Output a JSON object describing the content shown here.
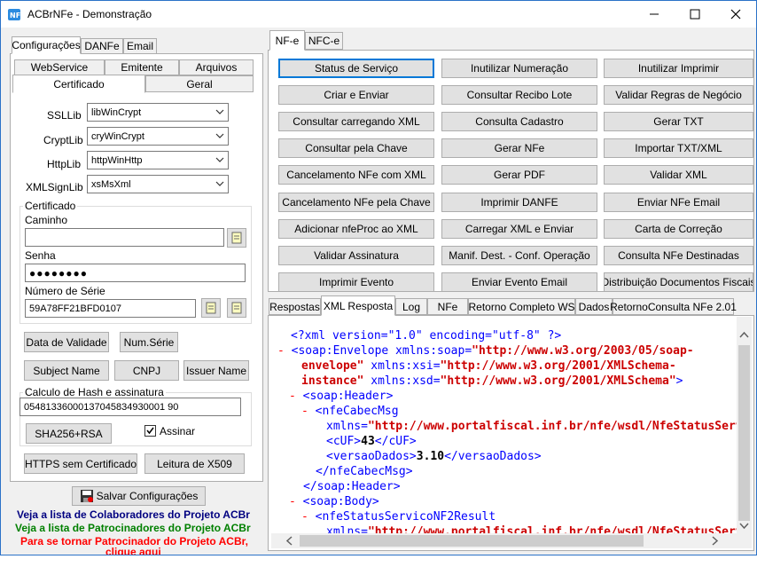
{
  "window": {
    "title": "ACBrNFe - Demonstração"
  },
  "left_tabs": [
    "Configurações",
    "DANFe",
    "Email"
  ],
  "config_tabs_row1": [
    "WebService",
    "Emitente",
    "Arquivos"
  ],
  "config_tabs_row2": [
    "Certificado",
    "Geral"
  ],
  "cert_settings": {
    "ssllib_label": "SSLLib",
    "ssllib_value": "libWinCrypt",
    "cryptlib_label": "CryptLib",
    "cryptlib_value": "cryWinCrypt",
    "httplib_label": "HttpLib",
    "httplib_value": "httpWinHttp",
    "xmlsignlib_label": "XMLSignLib",
    "xmlsignlib_value": "xsMsXml"
  },
  "certificado": {
    "group_title": "Certificado",
    "caminho_label": "Caminho",
    "caminho_value": "",
    "senha_label": "Senha",
    "senha_value": "●●●●●●●●",
    "serie_label": "Número de Série",
    "serie_value": "59A78FF21BFD0107"
  },
  "cert_buttons": {
    "data_validade": "Data de Validade",
    "num_serie": "Num.Série",
    "subject_name": "Subject Name",
    "cnpj": "CNPJ",
    "issuer_name": "Issuer Name"
  },
  "hash": {
    "group_title": "Calculo de Hash e assinatura",
    "value": "05481336000137045834930001 90",
    "sha_button": "SHA256+RSA",
    "assinar_label": "Assinar"
  },
  "bottom_buttons": {
    "https": "HTTPS sem Certificado",
    "leitura": "Leitura de X509"
  },
  "save_button": "Salvar Configurações",
  "links": {
    "colaboradores": "Veja a lista de Colaboradores do Projeto ACBr",
    "patrocinadores": "Veja a lista de Patrocinadores do Projeto ACBr",
    "patrocinador": "Para se tornar Patrocinador do Projeto ACBr,",
    "clique": "clique aqui",
    "color_blue": "#000080",
    "color_green": "#008000",
    "color_red": "#ff0000"
  },
  "right_tabs": [
    "NF-e",
    "NFC-e"
  ],
  "action_buttons": [
    [
      "Status de Serviço",
      "Inutilizar Numeração",
      "Inutilizar Imprimir"
    ],
    [
      "Criar e Enviar",
      "Consultar Recibo Lote",
      "Validar Regras de Negócio"
    ],
    [
      "Consultar carregando XML",
      "Consulta Cadastro",
      "Gerar TXT"
    ],
    [
      "Consultar pela Chave",
      "Gerar NFe",
      "Importar TXT/XML"
    ],
    [
      "Cancelamento NFe com XML",
      "Gerar PDF",
      "Validar XML"
    ],
    [
      "Cancelamento NFe pela Chave",
      "Imprimir DANFE",
      "Enviar NFe Email"
    ],
    [
      "Adicionar nfeProc ao XML",
      "Carregar XML e Enviar",
      "Carta de Correção"
    ],
    [
      "Validar Assinatura",
      "Manif. Dest. - Conf. Operação",
      "Consulta NFe Destinadas"
    ],
    [
      "Imprimir Evento",
      "Enviar Evento Email",
      "Distribuição Documentos Fiscais"
    ]
  ],
  "result_tabs": [
    "Respostas",
    "XML Resposta",
    "Log",
    "NFe",
    "Retorno Completo WS",
    "Dados",
    "RetornoConsulta NFe 2.01"
  ],
  "xml_lines": {
    "l1": "<?xml version=\"1.0\" encoding=\"utf-8\" ?>",
    "l2a": "<soap:Envelope xmlns:soap=",
    "l2b": "\"http://www.w3.org/2003/05/soap-",
    "l3a": "envelope\"",
    "l3b": " xmlns:xsi=",
    "l3c": "\"http://www.w3.org/2001/XMLSchema-",
    "l4a": "instance\"",
    "l4b": " xmlns:xsd=",
    "l4c": "\"http://www.w3.org/2001/XMLSchema\"",
    "l4d": ">",
    "l5": "<soap:Header>",
    "l6": "<nfeCabecMsg",
    "l7a": "xmlns=",
    "l7b": "\"http://www.portalfiscal.inf.br/nfe/wsdl/NfeStatusServico",
    "l8a": "<cUF>",
    "l8b": "43",
    "l8c": "</cUF>",
    "l9a": "<versaoDados>",
    "l9b": "3.10",
    "l9c": "</versaoDados>",
    "l10": "</nfeCabecMsg>",
    "l11": "</soap:Header>",
    "l12": "<soap:Body>",
    "l13": "<nfeStatusServicoNF2Result",
    "l14a": "xmlns=",
    "l14b": "\"http://www.portalfiscal.inf.br/nfe/wsdl/NfeStatusServico"
  }
}
